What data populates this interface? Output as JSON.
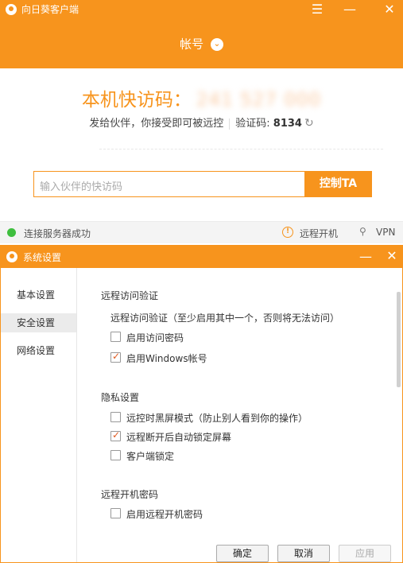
{
  "main_window": {
    "title": "向日葵客户端",
    "menu_icon": "☰",
    "min_icon": "—",
    "close_icon": "✕",
    "account_label": "帐号",
    "account_chevron": "⌄",
    "access_code_label": "本机快访码：",
    "access_code_value": "241 527 000",
    "info_text": "发给伙伴，你接受即可被远控",
    "verify_label": "验证码: ",
    "verify_code": "8134",
    "refresh_icon": "↻",
    "partner_input_placeholder": "输入伙伴的快访码",
    "control_button": "控制TA",
    "status_text": "连接服务器成功",
    "alert_icon_glyph": "!",
    "remote_boot_label": "远程开机",
    "vpn_icon_glyph": "⚲",
    "vpn_label": "VPN",
    "accent_color": "#f7941d",
    "status_color": "#3fbf3f"
  },
  "settings_window": {
    "title": "系统设置",
    "min_icon": "—",
    "close_icon": "✕",
    "nav_items": [
      {
        "label": "基本设置",
        "active": false
      },
      {
        "label": "安全设置",
        "active": true
      },
      {
        "label": "网络设置",
        "active": false
      }
    ],
    "sections": {
      "remote_access": {
        "title": "远程访问验证",
        "desc": "远程访问验证（至少启用其中一个，否则将无法访问）",
        "options": [
          {
            "label": "启用访问密码",
            "checked": false
          },
          {
            "label": "启用Windows帐号",
            "checked": true
          }
        ]
      },
      "privacy": {
        "title": "隐私设置",
        "options": [
          {
            "label": "远控时黑屏模式（防止别人看到你的操作）",
            "checked": false
          },
          {
            "label": "远程断开后自动锁定屏幕",
            "checked": true
          },
          {
            "label": "客户端锁定",
            "checked": false
          }
        ]
      },
      "remote_boot": {
        "title": "远程开机密码",
        "options": [
          {
            "label": "启用远程开机密码",
            "checked": false
          }
        ]
      }
    },
    "buttons": {
      "ok": "确定",
      "cancel": "取消",
      "apply": "应用"
    }
  }
}
